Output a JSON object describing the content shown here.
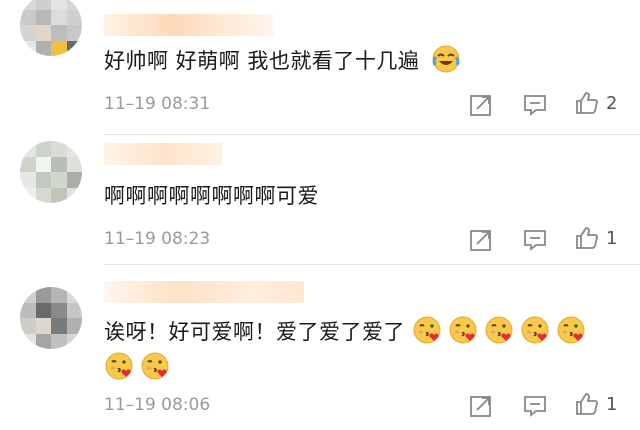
{
  "comments": [
    {
      "text": "好帅啊   好萌啊   我也就看了十几遍",
      "emoji": "crying-laughing-emoji",
      "time": "11–19 08:31",
      "likes": "2"
    },
    {
      "text": "啊啊啊啊啊啊啊啊可爱",
      "time": "11–19 08:23",
      "likes": "1"
    },
    {
      "text": "诶呀！好可爱啊！爱了爱了爱了",
      "emoji": "heart-kiss-emoji",
      "emoji_count": 7,
      "time": "11–19 08:06",
      "likes": "1"
    }
  ],
  "colors": {
    "namebar": "#fde6cf",
    "icon": "#888888",
    "time": "#9a9a9a"
  }
}
